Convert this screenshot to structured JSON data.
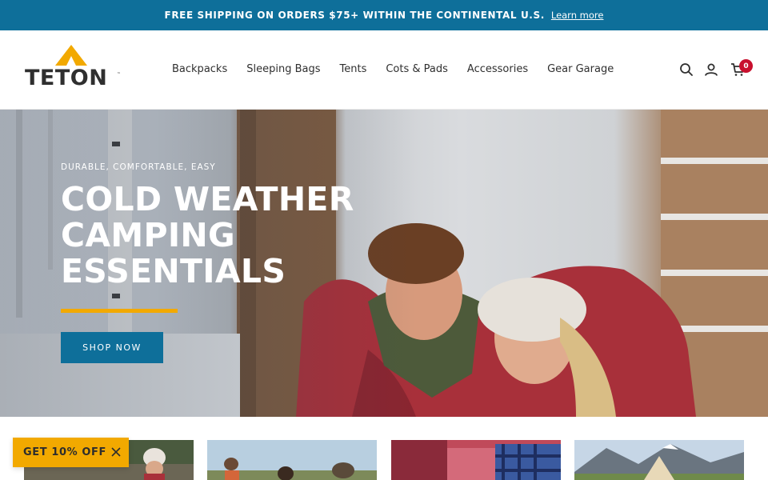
{
  "announcement": {
    "text": "FREE SHIPPING ON ORDERS $75+ WITHIN THE CONTINENTAL U.S.",
    "link": "Learn more"
  },
  "brand": {
    "name": "TETON",
    "trademark": "™",
    "accent_color": "#f2a900",
    "primary_color": "#0e6f9a"
  },
  "nav": {
    "items": [
      "Backpacks",
      "Sleeping Bags",
      "Tents",
      "Cots & Pads",
      "Accessories",
      "Gear Garage"
    ]
  },
  "header_icons": {
    "search": "search-icon",
    "account": "user-icon",
    "cart": "cart-icon",
    "cart_count": "0"
  },
  "hero": {
    "eyebrow": "DURABLE, COMFORTABLE, EASY",
    "title": "COLD WEATHER CAMPING ESSENTIALS",
    "cta": "SHOP NOW"
  },
  "popup": {
    "label": "GET 10% OFF"
  }
}
